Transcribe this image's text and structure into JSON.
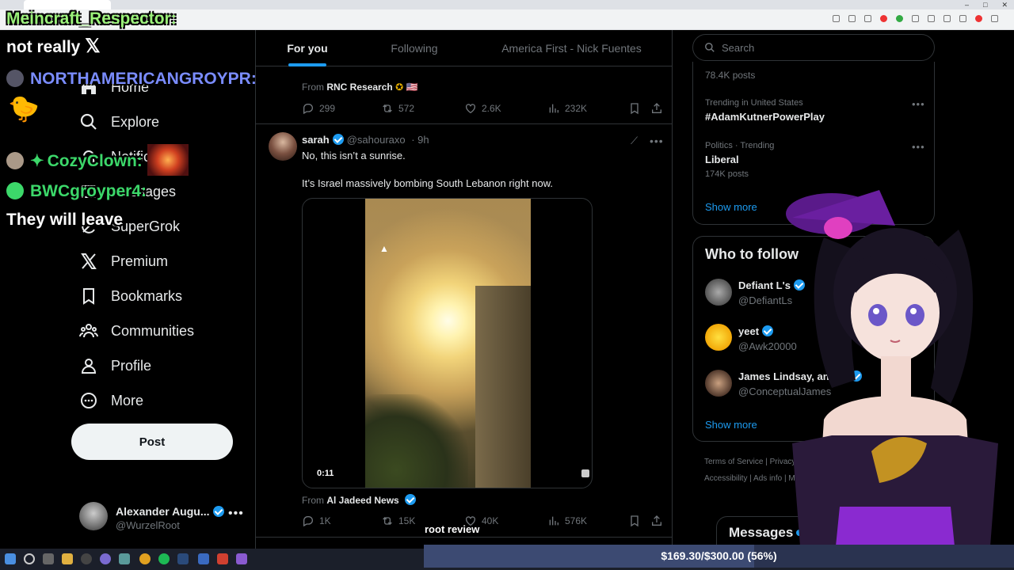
{
  "chat": [
    {
      "name": "Meincraft_Respector:",
      "color": "#9bf27a",
      "message": "not really"
    },
    {
      "name": "NORTHAMERICANGROYPR:",
      "color": "#7a8cff",
      "message": ""
    },
    {
      "name": "CozyClown:",
      "color": "#3cd86a",
      "message": ""
    },
    {
      "name": "BWCgroyper4:",
      "color": "#3cd86a",
      "message": "They will leave"
    }
  ],
  "nav": {
    "items": [
      {
        "label": "Home",
        "icon": "home-icon"
      },
      {
        "label": "Explore",
        "icon": "search-icon"
      },
      {
        "label": "Notific",
        "icon": "bell-icon"
      },
      {
        "label": "Messages",
        "icon": "mail-icon"
      },
      {
        "label": "SuperGrok",
        "icon": "grok-icon"
      },
      {
        "label": "Premium",
        "icon": "x-logo-icon"
      },
      {
        "label": "Bookmarks",
        "icon": "bookmark-icon"
      },
      {
        "label": "Communities",
        "icon": "communities-icon"
      },
      {
        "label": "Profile",
        "icon": "person-icon"
      },
      {
        "label": "More",
        "icon": "more-circle-icon"
      }
    ],
    "post_label": "Post",
    "account": {
      "name": "Alexander Augu...",
      "handle": "@WurzelRoot"
    }
  },
  "feed": {
    "tabs": [
      "For you",
      "Following",
      "America First - Nick Fuentes"
    ],
    "active_tab": "For you",
    "prev_tweet": {
      "from_label": "From",
      "from_source": "RNC Research",
      "replies": "299",
      "reposts": "572",
      "likes": "2.6K",
      "views": "232K"
    },
    "tweet": {
      "name": "sarah",
      "handle": "@sahouraxo",
      "time": "· 9h",
      "text_1": "No, this isn’t a sunrise.",
      "text_2": "It’s Israel massively bombing South Lebanon right now.",
      "video_duration": "0:11",
      "from_label": "From",
      "from_source": "Al Jadeed News",
      "replies": "1K",
      "reposts": "15K",
      "likes": "40K",
      "views": "576K"
    }
  },
  "sidebar": {
    "search_placeholder": "Search",
    "trends": [
      {
        "meta": "",
        "title": "",
        "posts": "78.4K posts"
      },
      {
        "meta": "Trending in United States",
        "title": "#AdamKutnerPowerPlay",
        "posts": ""
      },
      {
        "meta": "Politics · Trending",
        "title": "Liberal",
        "posts": "174K posts"
      }
    ],
    "show_more": "Show more",
    "who_to_follow_title": "Who to follow",
    "follow": [
      {
        "name": "Defiant L's",
        "handle": "@DefiantLs"
      },
      {
        "name": "yeet",
        "handle": "@Awk20000"
      },
      {
        "name": "James Lindsay, anti-...",
        "handle": "@ConceptualJames"
      }
    ],
    "follow_show_more": "Show more",
    "footer_1": "Terms of Service  |  Privacy Poli",
    "footer_2": "Accessibility  |  Ads info  |  M"
  },
  "messages_drawer": "Messages",
  "overlay": {
    "caption": "root review",
    "goal_text": "$169.30/$300.00 (56%)",
    "goal_fraction": 0.56
  }
}
